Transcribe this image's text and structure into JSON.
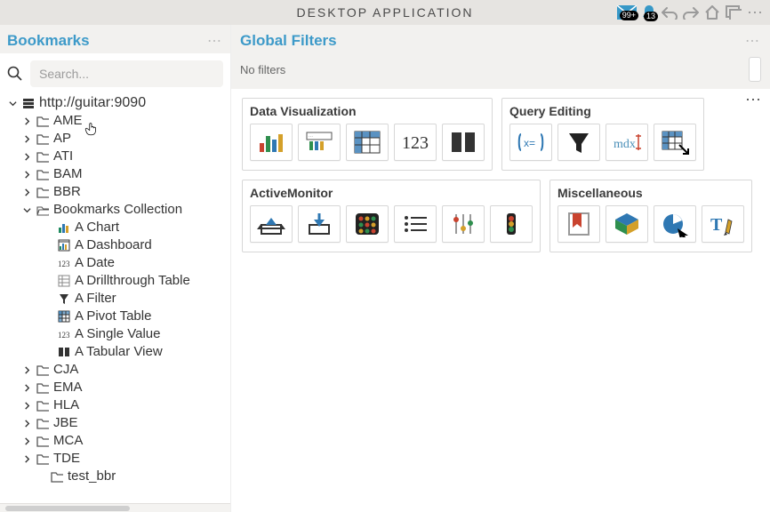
{
  "app": {
    "title": "DESKTOP APPLICATION",
    "badges": {
      "mail": "99+",
      "bell": "13"
    }
  },
  "sidebar": {
    "title": "Bookmarks",
    "search_placeholder": "Search...",
    "root": "http://guitar:9090",
    "folders": [
      "AME",
      "AP",
      "ATI",
      "BAM",
      "BBR"
    ],
    "collection": {
      "label": "Bookmarks Collection",
      "items": [
        {
          "label": "A Chart",
          "icon": "chart"
        },
        {
          "label": "A Dashboard",
          "icon": "dashboard"
        },
        {
          "label": "A Date",
          "icon": "number"
        },
        {
          "label": "A Drillthrough Table",
          "icon": "drill"
        },
        {
          "label": "A Filter",
          "icon": "filter"
        },
        {
          "label": "A Pivot Table",
          "icon": "pivot"
        },
        {
          "label": "A Single Value",
          "icon": "number"
        },
        {
          "label": "A Tabular View",
          "icon": "tabular"
        }
      ]
    },
    "folders2": [
      "CJA",
      "EMA",
      "HLA",
      "JBE",
      "MCA",
      "TDE"
    ],
    "leaf_folder": "test_bbr"
  },
  "filters": {
    "title": "Global Filters",
    "empty": "No filters"
  },
  "palette": {
    "groups": [
      {
        "title": "Data Visualization",
        "tiles": [
          "barchart",
          "featured",
          "pivot",
          "number",
          "tabular"
        ]
      },
      {
        "title": "Query Editing",
        "tiles": [
          "formula",
          "filter",
          "mdx",
          "drill"
        ]
      },
      {
        "title": "ActiveMonitor",
        "tiles": [
          "import",
          "export",
          "status",
          "list",
          "sliders",
          "traffic"
        ]
      },
      {
        "title": "Miscellaneous",
        "tiles": [
          "bookmark",
          "cube",
          "pieclick",
          "richtext"
        ]
      }
    ]
  }
}
